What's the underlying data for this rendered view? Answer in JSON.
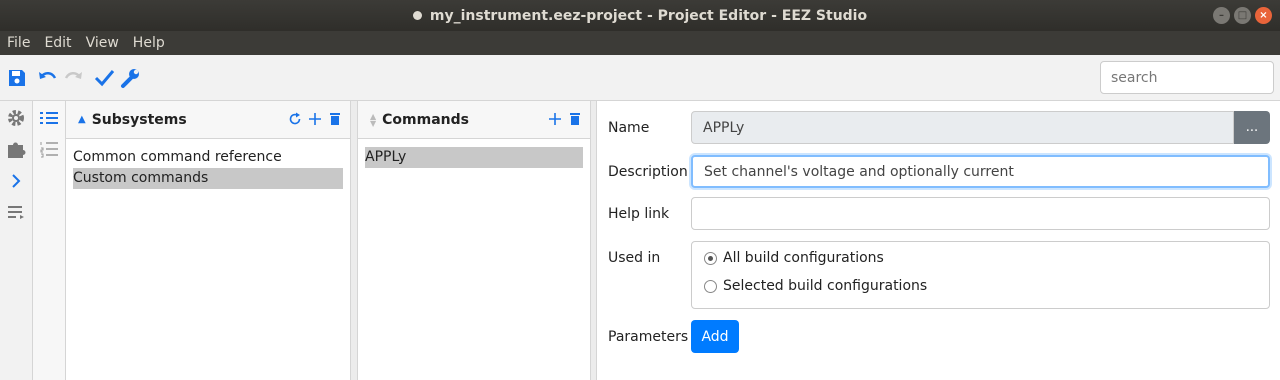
{
  "window": {
    "title": "my_instrument.eez-project - Project Editor - EEZ Studio"
  },
  "menu": [
    "File",
    "Edit",
    "View",
    "Help"
  ],
  "toolbar": {
    "search_placeholder": "search"
  },
  "subsystems": {
    "title": "Subsystems",
    "items": [
      {
        "label": "Common command reference",
        "selected": false
      },
      {
        "label": "Custom commands",
        "selected": true
      }
    ]
  },
  "commands": {
    "title": "Commands",
    "items": [
      {
        "label": "APPLy",
        "selected": true
      }
    ]
  },
  "form": {
    "name_label": "Name",
    "name_value": "APPLy",
    "name_button": "...",
    "description_label": "Description",
    "description_value": "Set channel's voltage and optionally current",
    "helplink_label": "Help link",
    "helplink_value": "",
    "usedin_label": "Used in",
    "usedin_options": [
      {
        "label": "All build configurations",
        "checked": true
      },
      {
        "label": "Selected build configurations",
        "checked": false
      }
    ],
    "parameters_label": "Parameters",
    "add_button": "Add"
  },
  "colors": {
    "accent": "#007bff",
    "icon_blue": "#1a73e8",
    "titlebar": "#3c3b37"
  }
}
